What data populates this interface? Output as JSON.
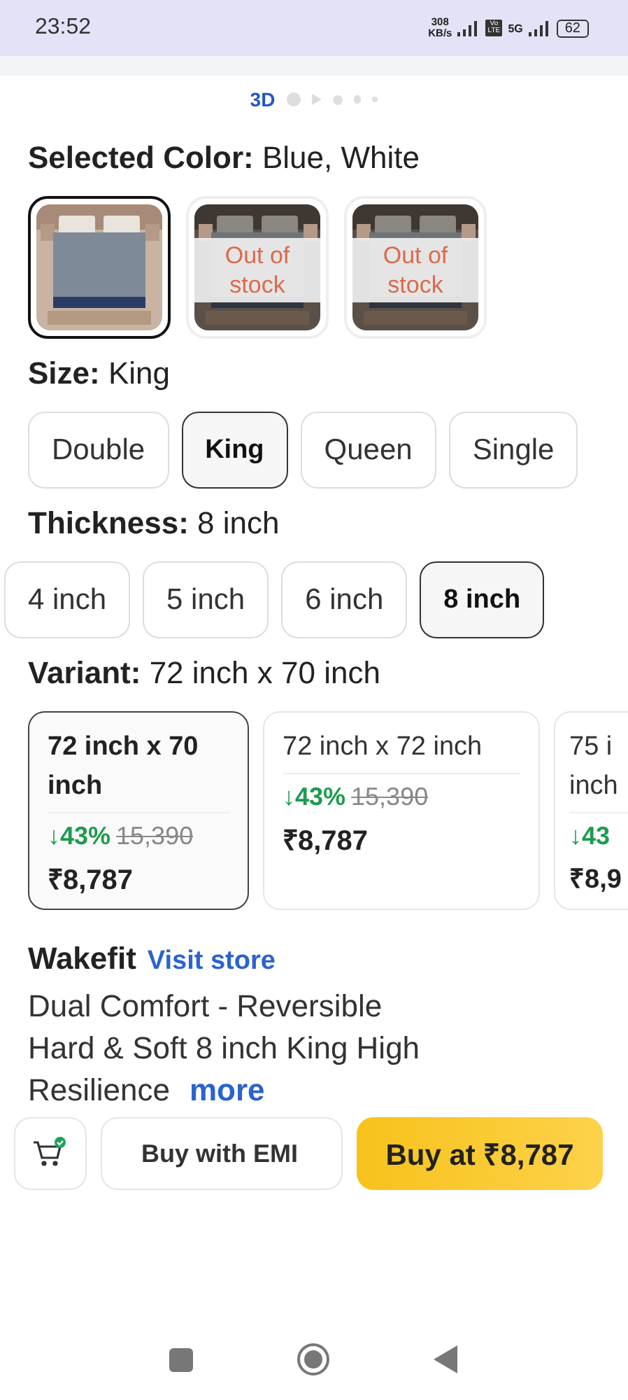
{
  "status_bar": {
    "time": "23:52",
    "speed_value": "308",
    "speed_unit": "KB/s",
    "volte": "Vo LTE",
    "network": "5G",
    "battery": "62"
  },
  "carousel": {
    "label": "3D",
    "dots": [
      {
        "kind": "dot"
      },
      {
        "kind": "play"
      },
      {
        "kind": "dot"
      },
      {
        "kind": "dot"
      },
      {
        "kind": "dot"
      }
    ]
  },
  "color": {
    "label": "Selected Color:",
    "value": "Blue, White",
    "swatches": [
      {
        "selected": true,
        "out_of_stock": false
      },
      {
        "selected": false,
        "out_of_stock": true,
        "note": "Out of stock"
      },
      {
        "selected": false,
        "out_of_stock": true,
        "note": "Out of stock"
      }
    ]
  },
  "size": {
    "label": "Size:",
    "value": "King",
    "options": [
      {
        "label": "Double",
        "selected": false
      },
      {
        "label": "King",
        "selected": true
      },
      {
        "label": "Queen",
        "selected": false
      },
      {
        "label": "Single",
        "selected": false
      }
    ]
  },
  "thickness": {
    "label": "Thickness:",
    "value": "8 inch",
    "options": [
      {
        "label": "4 inch",
        "selected": false
      },
      {
        "label": "5 inch",
        "selected": false
      },
      {
        "label": "6 inch",
        "selected": false
      },
      {
        "label": "8 inch",
        "selected": true
      }
    ]
  },
  "variant": {
    "label": "Variant:",
    "value": "72 inch x 70 inch",
    "options": [
      {
        "name": "72 inch x 70 inch",
        "discount": "↓43%",
        "mrp": "15,390",
        "price": "₹8,787",
        "selected": true
      },
      {
        "name": "72 inch x 72 inch",
        "discount": "↓43%",
        "mrp": "15,390",
        "price": "₹8,787",
        "selected": false
      },
      {
        "name": "75 i\ninch",
        "discount": "↓43",
        "price": "₹8,9",
        "selected": false
      }
    ]
  },
  "seller": {
    "brand": "Wakefit",
    "link": "Visit store"
  },
  "description": {
    "lines": [
      "Dual Comfort - Reversible",
      "Hard & Soft 8 inch King High",
      "Resilience"
    ],
    "more": "more"
  },
  "bottom_bar": {
    "emi": "Buy with EMI",
    "buy": "Buy at ₹8,787"
  }
}
